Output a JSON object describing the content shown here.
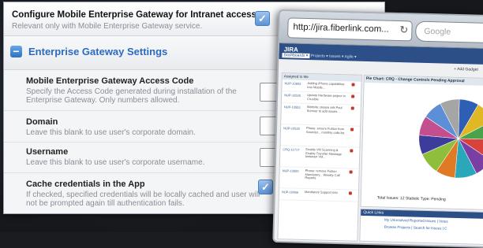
{
  "settings": {
    "configure": {
      "title": "Configure Mobile Enterprise Gateway for Intranet access",
      "subtitle": "Relevant only with Mobile Enterprise Gateway service.",
      "checked": true
    },
    "section": {
      "title": "Enterprise Gateway Settings",
      "toggle": "−"
    },
    "access_code": {
      "label": "Mobile Enterprise Gateway Access Code",
      "desc": "Specify the Access Code generated during installation of the Enterprise Gateway. Only numbers allowed.",
      "value": ""
    },
    "domain": {
      "label": "Domain",
      "desc": "Leave this blank to use user's corporate domain.",
      "value": ""
    },
    "username": {
      "label": "Username",
      "desc": "Leave this blank to use user's corporate username.",
      "value": ""
    },
    "cache": {
      "label": "Cache credentials in the App",
      "desc": "If checked, specified credentials will be locally cached and user will not be prompted again till authentication fails.",
      "checked": true
    },
    "check_glyph": "✓"
  },
  "browser": {
    "url": "http://jira.fiberlink.com...",
    "reload_icon": "↻",
    "search_placeholder": "Google",
    "jira": {
      "logo": "JIRA",
      "nav": [
        "Dashboards ▾",
        "Projects ▾",
        "Issues ▾",
        "Agile ▾"
      ],
      "add_gadget": "+ Add Gadget",
      "assigned_title": "Assigned to Me",
      "assigned_rows": [
        {
          "key": "NUP-10803",
          "summary": "Adding iPhone capabilities into Mobile..."
        },
        {
          "key": "NUP-10520",
          "summary": "Update Hardware project in Crucible"
        },
        {
          "key": "NUP-10553",
          "summary": "Website: please ask Paul Sumner to add issues..."
        },
        {
          "key": "NUP-10520",
          "summary": "Phase: ensure Fuition from Sounder... monthly calls list"
        },
        {
          "key": "CRQ-11717",
          "summary": "Enable VM Scanning & Enable Transfer Message between VM..."
        },
        {
          "key": "NUP-10500",
          "summary": "Phase: remove Fuition Mandatory... Weekly Call Reports"
        },
        {
          "key": "NUP-10486",
          "summary": "Mandatory Support Info"
        }
      ],
      "pie_title": "Pie Chart: CRQ - Change Controls Pending Approval",
      "totals": "Total Issues: 12   Statistic Type: Pending",
      "quick_title": "Quick Links",
      "quick_links": [
        "My Unresolved Reported Issues | Votes",
        "Browse Projects | Search for Issues | C"
      ],
      "pie_slices": [
        {
          "value": 8,
          "color": "#2f5fb5"
        },
        {
          "value": 9,
          "color": "#e0b825"
        },
        {
          "value": 8,
          "color": "#4aa34a"
        },
        {
          "value": 9,
          "color": "#d8423a"
        },
        {
          "value": 8,
          "color": "#7b3fa4"
        },
        {
          "value": 9,
          "color": "#2aa7b8"
        },
        {
          "value": 8,
          "color": "#e07a25"
        },
        {
          "value": 9,
          "color": "#8fbf3a"
        },
        {
          "value": 8,
          "color": "#3c3c9a"
        },
        {
          "value": 8,
          "color": "#c44f8f"
        },
        {
          "value": 8,
          "color": "#5c8fd6"
        },
        {
          "value": 8,
          "color": "#a5a5a5"
        }
      ]
    }
  }
}
